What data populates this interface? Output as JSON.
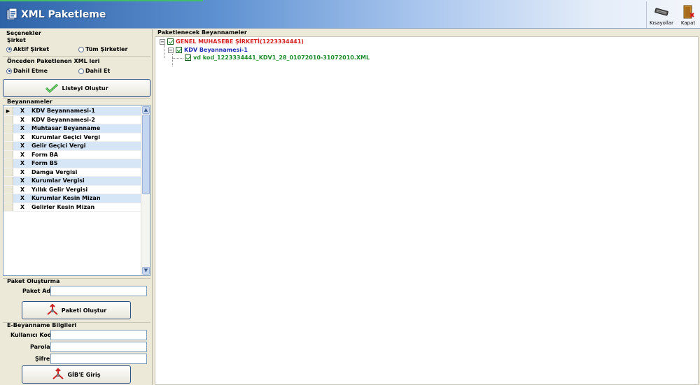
{
  "app": {
    "title": "XML Paketleme"
  },
  "toolbar": {
    "shortcuts_label": "Kısayollar",
    "close_label": "Kapat"
  },
  "options": {
    "title": "Seçenekler",
    "company": {
      "label": "Şirket",
      "options": [
        {
          "label": "Aktif Şirket",
          "selected": true
        },
        {
          "label": "Tüm Şirketler",
          "selected": false
        }
      ]
    },
    "previous": {
      "label": "Önceden Paketlenen XML leri",
      "options": [
        {
          "label": "Dahil Etme",
          "selected": true
        },
        {
          "label": "Dahil Et",
          "selected": false
        }
      ]
    },
    "create_list_label": "Listeyi Oluştur"
  },
  "declarations": {
    "title": "Beyannameler",
    "rows": [
      {
        "mark": "X",
        "name": "KDV Beyannamesi-1"
      },
      {
        "mark": "X",
        "name": "KDV Beyannamesi-2"
      },
      {
        "mark": "X",
        "name": "Muhtasar Beyanname"
      },
      {
        "mark": "X",
        "name": "Kurumlar Geçici Vergi"
      },
      {
        "mark": "X",
        "name": "Gelir Geçici Vergi"
      },
      {
        "mark": "X",
        "name": "Form BA"
      },
      {
        "mark": "X",
        "name": "Form BS"
      },
      {
        "mark": "X",
        "name": "Damga Vergisi"
      },
      {
        "mark": "X",
        "name": "Kurumlar Vergisi"
      },
      {
        "mark": "X",
        "name": "Yıllık Gelir Vergisi"
      },
      {
        "mark": "X",
        "name": "Kurumlar Kesin Mizan"
      },
      {
        "mark": "X",
        "name": "Gelirler Kesin Mizan"
      }
    ]
  },
  "package": {
    "title": "Paket Oluşturma",
    "name_label": "Paket Adı",
    "name_value": "",
    "create_label": "Paketi Oluştur"
  },
  "ebeyan": {
    "title": "E-Beyanname Bilgileri",
    "user_label": "Kullanıcı Kodu",
    "password_label": "Parola",
    "cipher_label": "Şifre",
    "login_label": "GİB'E Giriş"
  },
  "tree": {
    "title": "Paketlenecek Beyannameler",
    "company": "GENEL MUHASEBE ŞİRKETİ(1223334441)",
    "declaration": "KDV Beyannamesi-1",
    "file": "vd kod_1223334441_KDV1_28_01072010-31072010.XML"
  },
  "colors": {
    "company": "#d42020",
    "declaration": "#1f2fb0",
    "file": "#1a8a2a",
    "row_alt": "#d7e6f7"
  }
}
